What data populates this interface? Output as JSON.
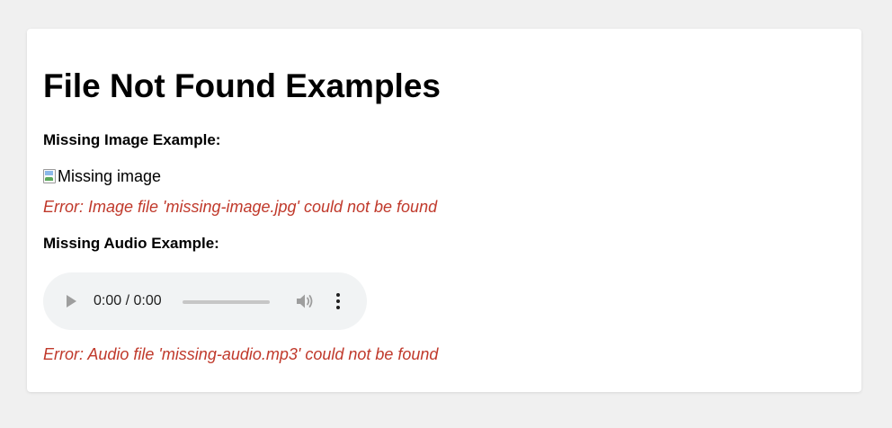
{
  "page": {
    "title": "File Not Found Examples"
  },
  "image_example": {
    "label": "Missing Image Example:",
    "alt_text": "Missing image",
    "error": "Error: Image file 'missing-image.jpg' could not be found"
  },
  "audio_example": {
    "label": "Missing Audio Example:",
    "time": "0:00 / 0:00",
    "error": "Error: Audio file 'missing-audio.mp3' could not be found",
    "progress": 0
  },
  "icons": {
    "play": "play-icon",
    "volume": "volume-icon",
    "more": "more-options-icon",
    "broken_image": "broken-image-icon"
  },
  "colors": {
    "background": "#f0f0f0",
    "card": "#ffffff",
    "error": "#c0392b",
    "player_bg": "#f1f3f4"
  }
}
